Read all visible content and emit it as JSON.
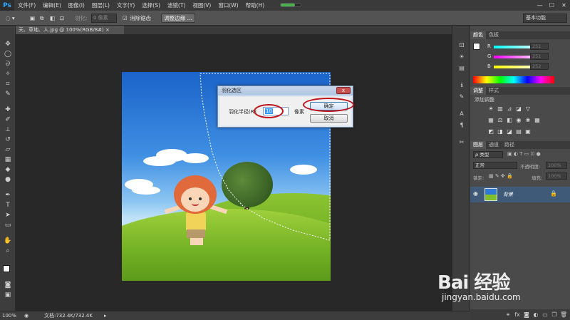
{
  "app": {
    "logo": "Ps"
  },
  "menubar": {
    "items": [
      "文件(F)",
      "编辑(E)",
      "图像(I)",
      "图层(L)",
      "文字(Y)",
      "选择(S)",
      "滤镜(T)",
      "视图(V)",
      "窗口(W)",
      "帮助(H)"
    ],
    "window_controls": [
      "—",
      "☐",
      "✕"
    ]
  },
  "options": {
    "feather_label": "羽化:",
    "feather_value": "0 像素",
    "antialias_label": "消除锯齿",
    "refine_edge_label": "调整边缘 ...",
    "workspace": "基本功能"
  },
  "document": {
    "tab_title": "天、草地、人.jpg @ 100%(RGB/8#)",
    "tab_close": "×"
  },
  "dialog": {
    "title": "羽化选区",
    "close": "x",
    "radius_label": "羽化半径(R):",
    "radius_value": "10",
    "unit": "像素",
    "ok": "确定",
    "cancel": "取消"
  },
  "status": {
    "zoom": "100%",
    "doc_info": "文档:732.4K/732.4K"
  },
  "color_panel": {
    "tabs": [
      "颜色",
      "色板"
    ],
    "channels": [
      {
        "label": "R",
        "value": "251"
      },
      {
        "label": "G",
        "value": "251"
      },
      {
        "label": "B",
        "value": "252"
      }
    ]
  },
  "adjust_panel": {
    "tabs": [
      "调整",
      "样式"
    ],
    "hint": "添加调整"
  },
  "layers_panel": {
    "tabs": [
      "图层",
      "通道",
      "路径"
    ],
    "filter": "ρ 类型",
    "blend_mode": "正常",
    "opacity_label": "不透明度:",
    "opacity_value": "100%",
    "lock_label": "锁定:",
    "fill_label": "填充:",
    "fill_value": "100%",
    "layer_name": "背景"
  },
  "watermark": {
    "logo": "Bai 经验",
    "url": "jingyan.baidu.com"
  }
}
